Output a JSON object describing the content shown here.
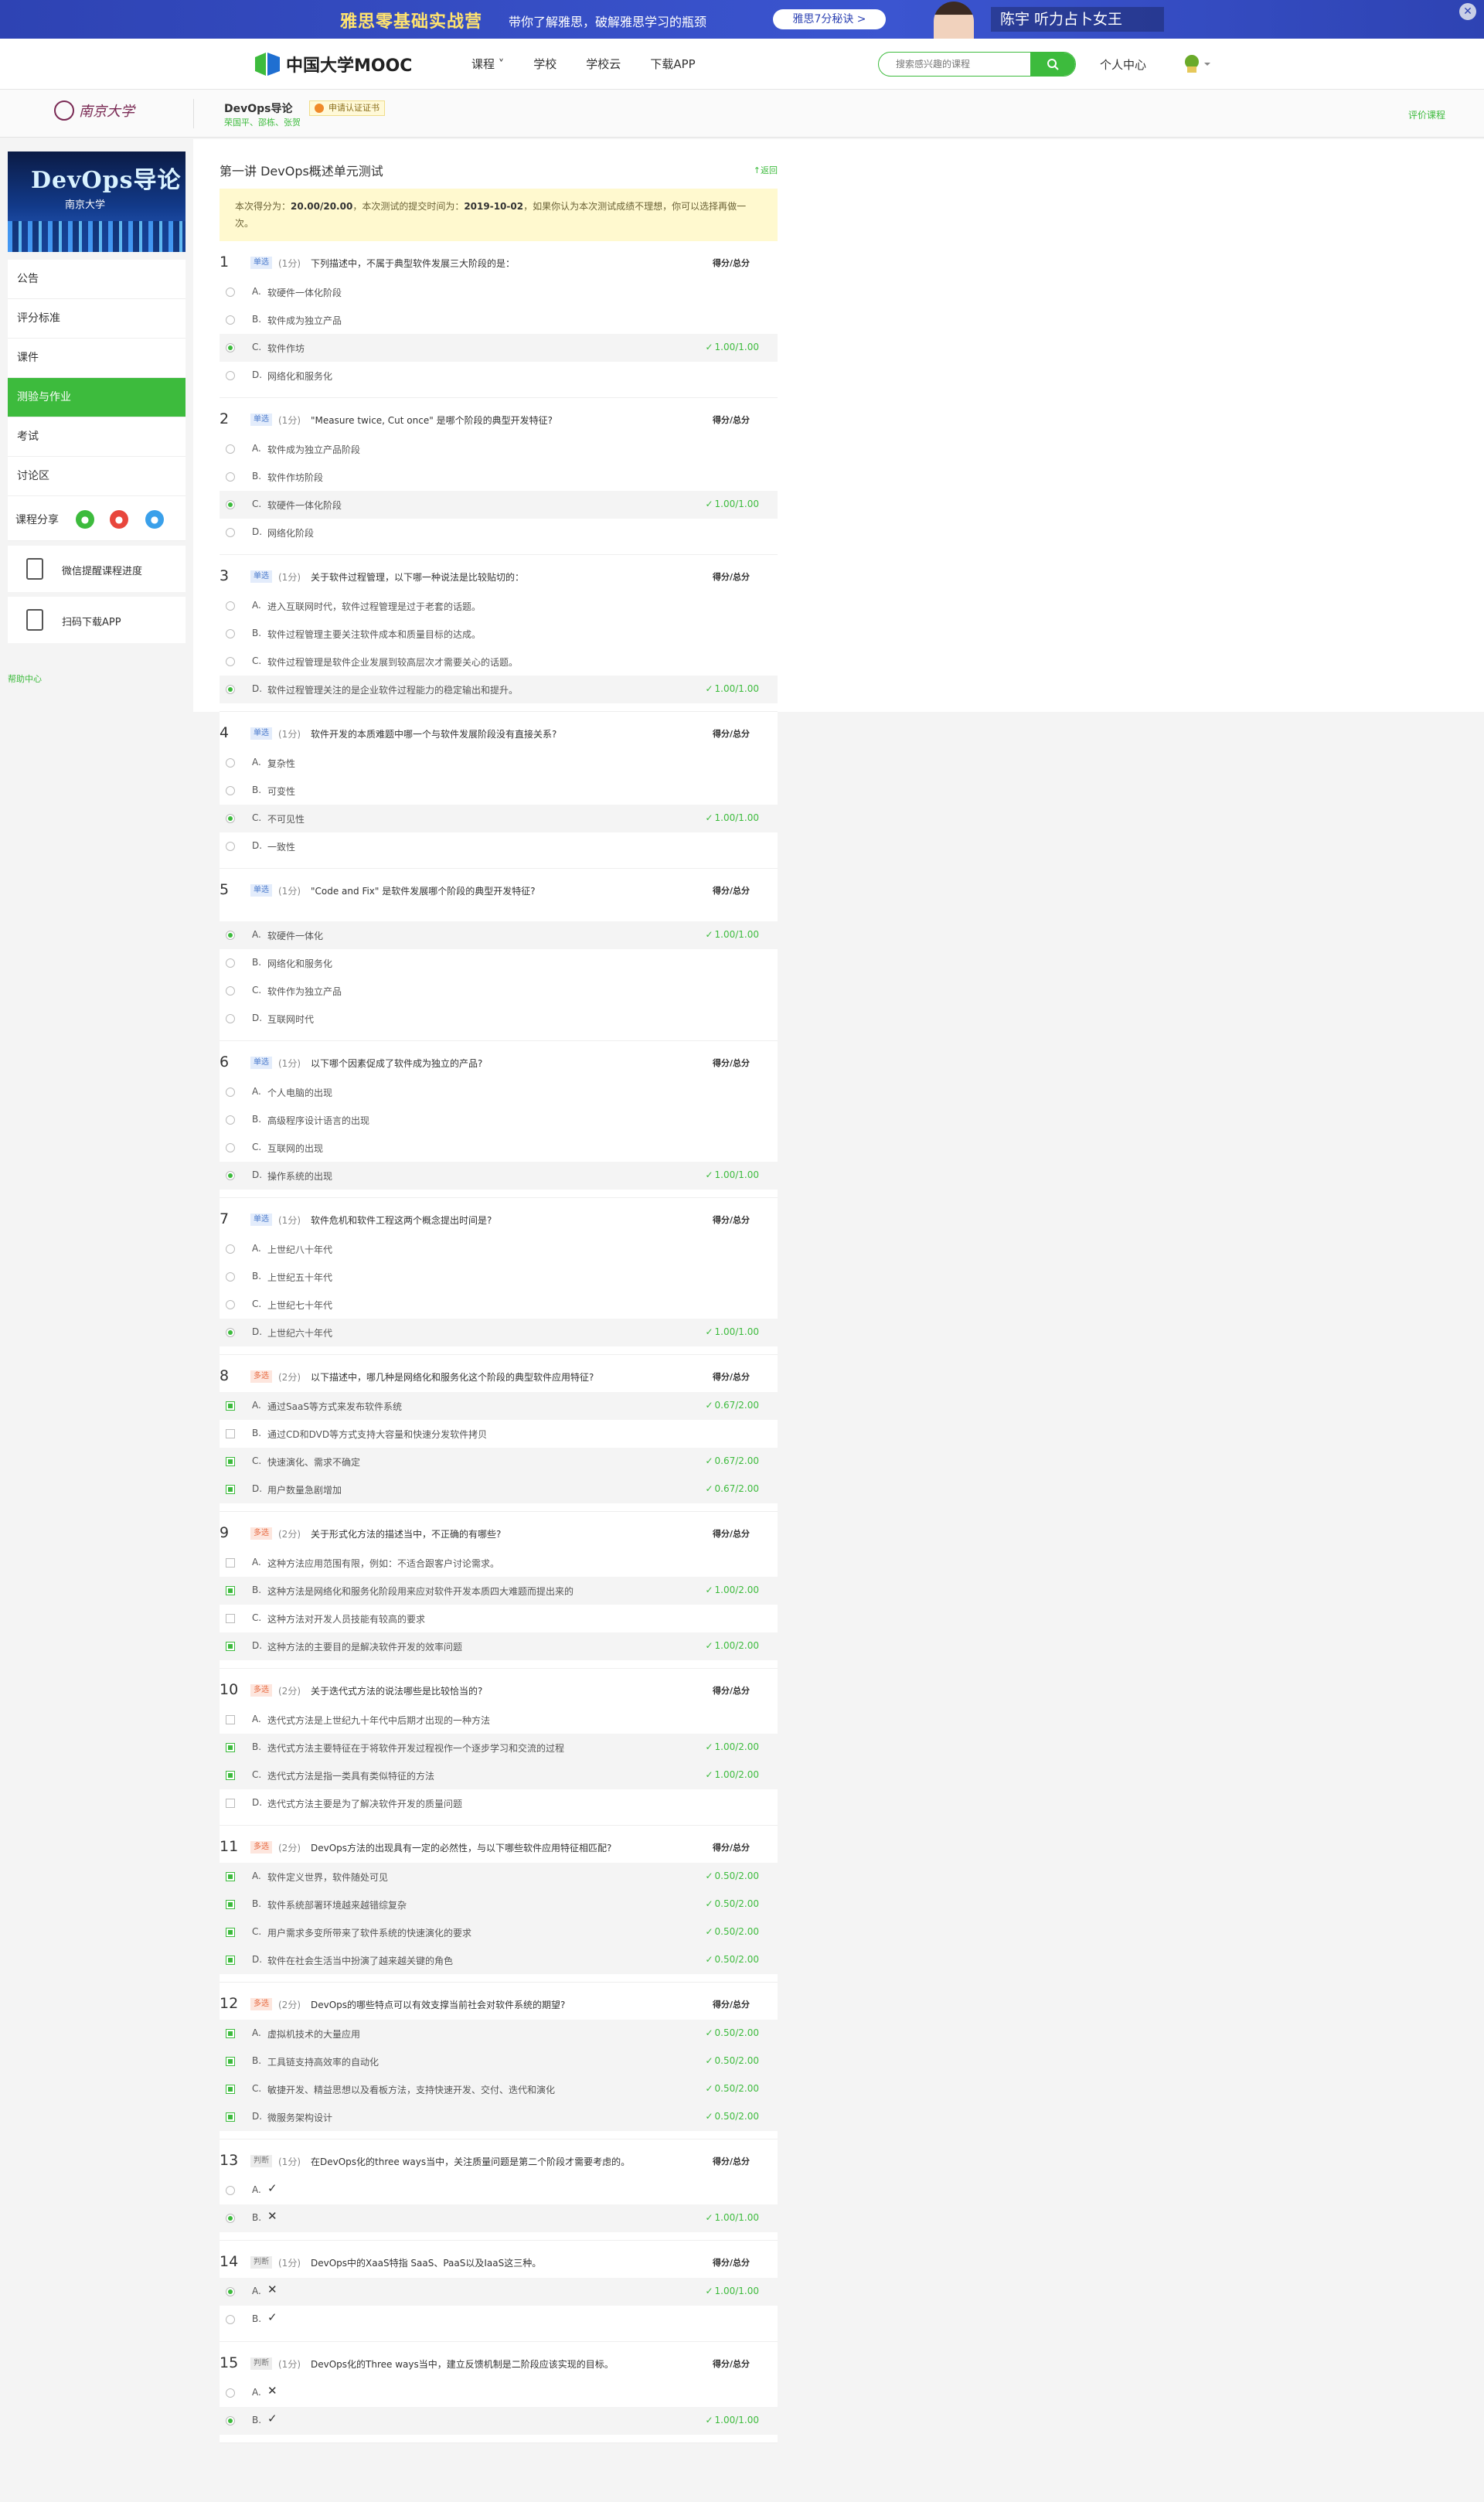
{
  "ad": {
    "title": "雅思零基础实战营",
    "subtitle": "带你了解雅思，破解雅思学习的瓶颈",
    "button": "雅思7分秘诀 >",
    "chip": "陈宇  听力占卜女王",
    "close": "✕"
  },
  "nav": {
    "logo": "中国大学MOOC",
    "items": [
      "课程 ˅",
      "学校",
      "学校云",
      "下载APP"
    ],
    "search_placeholder": "搜索感兴趣的课程",
    "search_icon": "search-icon",
    "me": "个人中心",
    "avatar": "avatar-icon"
  },
  "course": {
    "university": "南京大学",
    "name": "DevOps导论",
    "teachers": "荣国平、邵栋、张贺",
    "cert": "申请认证证书",
    "evaluate": "评价课程"
  },
  "sidebar": {
    "banner_title": "DevOps导论",
    "banner_sub": "南京大学",
    "items": [
      {
        "label": "公告",
        "active": false
      },
      {
        "label": "评分标准",
        "active": false
      },
      {
        "label": "课件",
        "active": false
      },
      {
        "label": "测验与作业",
        "active": true
      },
      {
        "label": "考试",
        "active": false
      },
      {
        "label": "讨论区",
        "active": false
      }
    ],
    "share_label": "课程分享",
    "share_icons": [
      "wechat-icon",
      "weibo-icon",
      "qq-icon"
    ],
    "card1": "微信提醒课程进度",
    "card2": "扫码下载APP",
    "help": "帮助中心"
  },
  "quiz": {
    "title": "第一讲 DevOps概述单元测试",
    "back": "返回",
    "notice_pre": "本次得分为：",
    "notice_score": "20.00/20.00",
    "notice_mid": "，本次测试的提交时间为：",
    "notice_date": "2019-10-02",
    "notice_post": "，如果你认为本次测试成绩不理想，你可以选择再做一次。",
    "score_label": "得分/总分",
    "questions": [
      {
        "no": "1",
        "type": "单选",
        "kind": "single",
        "pts": "(1分)",
        "stem": "下列描述中，不属于典型软件发展三大阶段的是：",
        "options": [
          {
            "l": "A.",
            "t": "软硬件一体化阶段",
            "sel": false,
            "r": ""
          },
          {
            "l": "B.",
            "t": "软件成为独立产品",
            "sel": false,
            "r": ""
          },
          {
            "l": "C.",
            "t": "软件作坊",
            "sel": true,
            "r": "1.00/1.00"
          },
          {
            "l": "D.",
            "t": "网络化和服务化",
            "sel": false,
            "r": ""
          }
        ]
      },
      {
        "no": "2",
        "type": "单选",
        "kind": "single",
        "pts": "(1分)",
        "stem": "\"Measure twice, Cut once\" 是哪个阶段的典型开发特征?",
        "options": [
          {
            "l": "A.",
            "t": "软件成为独立产品阶段",
            "sel": false,
            "r": ""
          },
          {
            "l": "B.",
            "t": "软件作坊阶段",
            "sel": false,
            "r": ""
          },
          {
            "l": "C.",
            "t": "软硬件一体化阶段",
            "sel": true,
            "r": "1.00/1.00"
          },
          {
            "l": "D.",
            "t": "网络化阶段",
            "sel": false,
            "r": ""
          }
        ]
      },
      {
        "no": "3",
        "type": "单选",
        "kind": "single",
        "pts": "(1分)",
        "stem": "关于软件过程管理，以下哪一种说法是比较贴切的：",
        "options": [
          {
            "l": "A.",
            "t": "进入互联网时代，软件过程管理是过于老套的话题。",
            "sel": false,
            "r": ""
          },
          {
            "l": "B.",
            "t": "软件过程管理主要关注软件成本和质量目标的达成。",
            "sel": false,
            "r": ""
          },
          {
            "l": "C.",
            "t": "软件过程管理是软件企业发展到较高层次才需要关心的话题。",
            "sel": false,
            "r": ""
          },
          {
            "l": "D.",
            "t": "软件过程管理关注的是企业软件过程能力的稳定输出和提升。",
            "sel": true,
            "r": "1.00/1.00"
          }
        ]
      },
      {
        "no": "4",
        "type": "单选",
        "kind": "single",
        "pts": "(1分)",
        "stem": "软件开发的本质难题中哪一个与软件发展阶段没有直接关系?",
        "options": [
          {
            "l": "A.",
            "t": "复杂性",
            "sel": false,
            "r": ""
          },
          {
            "l": "B.",
            "t": "可变性",
            "sel": false,
            "r": ""
          },
          {
            "l": "C.",
            "t": "不可见性",
            "sel": true,
            "r": "1.00/1.00"
          },
          {
            "l": "D.",
            "t": "一致性",
            "sel": false,
            "r": ""
          }
        ]
      },
      {
        "no": "5",
        "type": "单选",
        "kind": "single",
        "pts": "(1分)",
        "stem": "\"Code and Fix\" 是软件发展哪个阶段的典型开发特征?",
        "spaced": true,
        "options": [
          {
            "l": "A.",
            "t": "软硬件一体化",
            "sel": true,
            "r": "1.00/1.00"
          },
          {
            "l": "B.",
            "t": "网络化和服务化",
            "sel": false,
            "r": ""
          },
          {
            "l": "C.",
            "t": "软件作为独立产品",
            "sel": false,
            "r": ""
          },
          {
            "l": "D.",
            "t": "互联网时代",
            "sel": false,
            "r": ""
          }
        ]
      },
      {
        "no": "6",
        "type": "单选",
        "kind": "single",
        "pts": "(1分)",
        "stem": "以下哪个因素促成了软件成为独立的产品?",
        "options": [
          {
            "l": "A.",
            "t": "个人电脑的出现",
            "sel": false,
            "r": ""
          },
          {
            "l": "B.",
            "t": "高级程序设计语言的出现",
            "sel": false,
            "r": ""
          },
          {
            "l": "C.",
            "t": "互联网的出现",
            "sel": false,
            "r": ""
          },
          {
            "l": "D.",
            "t": "操作系统的出现",
            "sel": true,
            "r": "1.00/1.00"
          }
        ]
      },
      {
        "no": "7",
        "type": "单选",
        "kind": "single",
        "pts": "(1分)",
        "stem": "软件危机和软件工程这两个概念提出时间是?",
        "options": [
          {
            "l": "A.",
            "t": "上世纪八十年代",
            "sel": false,
            "r": ""
          },
          {
            "l": "B.",
            "t": "上世纪五十年代",
            "sel": false,
            "r": ""
          },
          {
            "l": "C.",
            "t": "上世纪七十年代",
            "sel": false,
            "r": ""
          },
          {
            "l": "D.",
            "t": "上世纪六十年代",
            "sel": true,
            "r": "1.00/1.00"
          }
        ]
      },
      {
        "no": "8",
        "type": "多选",
        "kind": "multi",
        "pts": "(2分)",
        "stem": "以下描述中，哪几种是网络化和服务化这个阶段的典型软件应用特征?",
        "options": [
          {
            "l": "A.",
            "t": "通过SaaS等方式来发布软件系统",
            "sel": true,
            "r": "0.67/2.00"
          },
          {
            "l": "B.",
            "t": "通过CD和DVD等方式支持大容量和快速分发软件拷贝",
            "sel": false,
            "r": ""
          },
          {
            "l": "C.",
            "t": "快速演化、需求不确定",
            "sel": true,
            "r": "0.67/2.00"
          },
          {
            "l": "D.",
            "t": "用户数量急剧增加",
            "sel": true,
            "r": "0.67/2.00"
          }
        ]
      },
      {
        "no": "9",
        "type": "多选",
        "kind": "multi",
        "pts": "(2分)",
        "stem": "关于形式化方法的描述当中，不正确的有哪些?",
        "options": [
          {
            "l": "A.",
            "t": "这种方法应用范围有限，例如：不适合跟客户讨论需求。",
            "sel": false,
            "r": ""
          },
          {
            "l": "B.",
            "t": "这种方法是网络化和服务化阶段用来应对软件开发本质四大难题而提出来的",
            "sel": true,
            "r": "1.00/2.00"
          },
          {
            "l": "C.",
            "t": "这种方法对开发人员技能有较高的要求",
            "sel": false,
            "r": ""
          },
          {
            "l": "D.",
            "t": "这种方法的主要目的是解决软件开发的效率问题",
            "sel": true,
            "r": "1.00/2.00"
          }
        ]
      },
      {
        "no": "10",
        "type": "多选",
        "kind": "multi",
        "pts": "(2分)",
        "stem": "关于迭代式方法的说法哪些是比较恰当的?",
        "options": [
          {
            "l": "A.",
            "t": "迭代式方法是上世纪九十年代中后期才出现的一种方法",
            "sel": false,
            "r": ""
          },
          {
            "l": "B.",
            "t": "迭代式方法主要特征在于将软件开发过程视作一个逐步学习和交流的过程",
            "sel": true,
            "r": "1.00/2.00"
          },
          {
            "l": "C.",
            "t": "迭代式方法是指一类具有类似特征的方法",
            "sel": true,
            "r": "1.00/2.00"
          },
          {
            "l": "D.",
            "t": "迭代式方法主要是为了解决软件开发的质量问题",
            "sel": false,
            "r": ""
          }
        ]
      },
      {
        "no": "11",
        "type": "多选",
        "kind": "multi",
        "pts": "(2分)",
        "stem": "DevOps方法的出现具有一定的必然性，与以下哪些软件应用特征相匹配?",
        "options": [
          {
            "l": "A.",
            "t": "软件定义世界，软件随处可见",
            "sel": true,
            "r": "0.50/2.00"
          },
          {
            "l": "B.",
            "t": "软件系统部署环境越来越错综复杂",
            "sel": true,
            "r": "0.50/2.00"
          },
          {
            "l": "C.",
            "t": "用户需求多变所带来了软件系统的快速演化的要求",
            "sel": true,
            "r": "0.50/2.00"
          },
          {
            "l": "D.",
            "t": "软件在社会生活当中扮演了越来越关键的角色",
            "sel": true,
            "r": "0.50/2.00"
          }
        ]
      },
      {
        "no": "12",
        "type": "多选",
        "kind": "multi",
        "pts": "(2分)",
        "stem": "DevOps的哪些特点可以有效支撑当前社会对软件系统的期望?",
        "options": [
          {
            "l": "A.",
            "t": "虚拟机技术的大量应用",
            "sel": true,
            "r": "0.50/2.00"
          },
          {
            "l": "B.",
            "t": "工具链支持高效率的自动化",
            "sel": true,
            "r": "0.50/2.00"
          },
          {
            "l": "C.",
            "t": "敏捷开发、精益思想以及看板方法，支持快速开发、交付、迭代和演化",
            "sel": true,
            "r": "0.50/2.00"
          },
          {
            "l": "D.",
            "t": "微服务架构设计",
            "sel": true,
            "r": "0.50/2.00"
          }
        ]
      },
      {
        "no": "13",
        "type": "判断",
        "kind": "judge",
        "pts": "(1分)",
        "stem": "在DevOps化的three ways当中，关注质量问题是第二个阶段才需要考虑的。",
        "options": [
          {
            "l": "A.",
            "t": "✓",
            "sel": false,
            "r": ""
          },
          {
            "l": "B.",
            "t": "✕",
            "sel": true,
            "r": "1.00/1.00"
          }
        ]
      },
      {
        "no": "14",
        "type": "判断",
        "kind": "judge",
        "pts": "(1分)",
        "stem": "DevOps中的XaaS特指 SaaS、PaaS以及IaaS这三种。",
        "options": [
          {
            "l": "A.",
            "t": "✕",
            "sel": true,
            "r": "1.00/1.00"
          },
          {
            "l": "B.",
            "t": "✓",
            "sel": false,
            "r": ""
          }
        ]
      },
      {
        "no": "15",
        "type": "判断",
        "kind": "judge",
        "pts": "(1分)",
        "stem": "DevOps化的Three ways当中，建立反馈机制是二阶段应该实现的目标。",
        "options": [
          {
            "l": "A.",
            "t": "✕",
            "sel": false,
            "r": ""
          },
          {
            "l": "B.",
            "t": "✓",
            "sel": true,
            "r": "1.00/1.00"
          }
        ]
      }
    ]
  },
  "colors": {
    "accent": "#3dbb3d",
    "ad_bg": "#2e43b3",
    "notice_bg": "#fff9cf"
  }
}
